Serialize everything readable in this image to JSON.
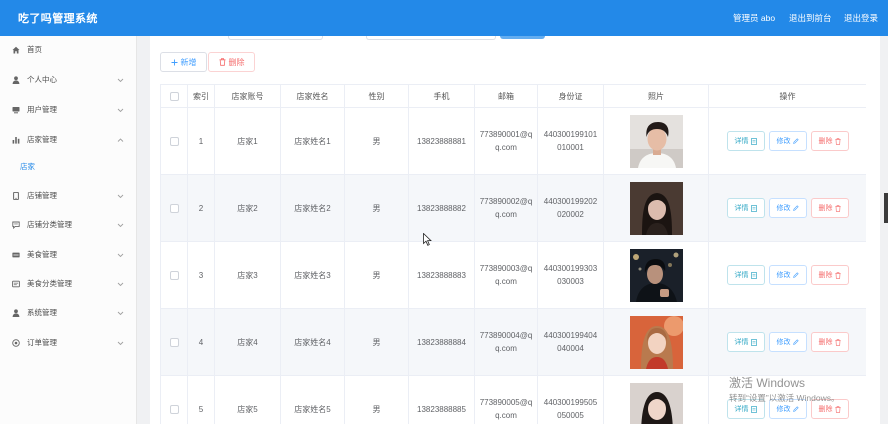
{
  "app": {
    "title": "吃了吗管理系统"
  },
  "header": {
    "admin_label": "管理员 abo",
    "to_front": "退出到前台",
    "logout": "退出登录"
  },
  "sidebar": {
    "items": [
      {
        "label": "首页",
        "icon": "home-icon"
      },
      {
        "label": "个人中心",
        "icon": "user-icon",
        "expandable": true
      },
      {
        "label": "用户管理",
        "icon": "card-icon",
        "expandable": true
      },
      {
        "label": "店家管理",
        "icon": "bar-chart-icon",
        "expandable": true,
        "expanded": true,
        "children": [
          {
            "label": "店家",
            "active": true
          }
        ]
      },
      {
        "label": "店铺管理",
        "icon": "mobile-icon",
        "expandable": true
      },
      {
        "label": "店铺分类管理",
        "icon": "chat-icon",
        "expandable": true
      },
      {
        "label": "美食管理",
        "icon": "tray-icon",
        "expandable": true
      },
      {
        "label": "美食分类管理",
        "icon": "message-icon",
        "expandable": true
      },
      {
        "label": "系统管理",
        "icon": "user-icon",
        "expandable": true
      },
      {
        "label": "订单管理",
        "icon": "circle-icon",
        "expandable": true
      }
    ]
  },
  "toolbar": {
    "add_label": "新增",
    "add_icon": "plus-icon",
    "delete_label": "删除",
    "delete_icon": "trash-icon"
  },
  "table": {
    "columns": {
      "index": "索引",
      "account": "店家账号",
      "name": "店家姓名",
      "gender": "性别",
      "phone": "手机",
      "email": "邮箱",
      "id_card": "身份证",
      "photo": "照片",
      "actions": "操作"
    },
    "rows": [
      {
        "index": "1",
        "account": "店家1",
        "name": "店家姓名1",
        "gender": "男",
        "phone": "13823888881",
        "email": "773890001@qq.com",
        "id_card": "440300199101010001"
      },
      {
        "index": "2",
        "account": "店家2",
        "name": "店家姓名2",
        "gender": "男",
        "phone": "13823888882",
        "email": "773890002@qq.com",
        "id_card": "440300199202020002"
      },
      {
        "index": "3",
        "account": "店家3",
        "name": "店家姓名3",
        "gender": "男",
        "phone": "13823888883",
        "email": "773890003@qq.com",
        "id_card": "440300199303030003"
      },
      {
        "index": "4",
        "account": "店家4",
        "name": "店家姓名4",
        "gender": "男",
        "phone": "13823888884",
        "email": "773890004@qq.com",
        "id_card": "440300199404040004"
      },
      {
        "index": "5",
        "account": "店家5",
        "name": "店家姓名5",
        "gender": "男",
        "phone": "13823888885",
        "email": "773890005@qq.com",
        "id_card": "440300199505050005"
      }
    ]
  },
  "row_actions": {
    "detail": "详情",
    "detail_icon": "document-icon",
    "edit": "修改",
    "edit_icon": "edit-icon",
    "delete": "删除",
    "delete_icon": "trash-icon"
  },
  "watermark": {
    "title": "激活 Windows",
    "subtitle": "转到“设置”以激活 Windows。"
  },
  "colors": {
    "header_bg": "#2389e8",
    "primary": "#409eff",
    "danger": "#f56c6c",
    "info": "#34a9c6",
    "active_menu": "#2389e8",
    "row_alt_bg": "#f5f7fa"
  }
}
